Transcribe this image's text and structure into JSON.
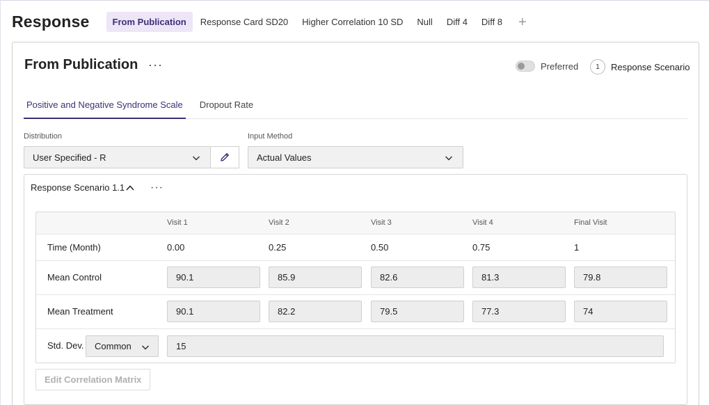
{
  "header": {
    "title": "Response",
    "tabs": [
      {
        "label": "From Publication",
        "active": true
      },
      {
        "label": "Response Card SD20",
        "active": false
      },
      {
        "label": "Higher Correlation 10 SD",
        "active": false
      },
      {
        "label": "Null",
        "active": false
      },
      {
        "label": "Diff 4",
        "active": false
      },
      {
        "label": "Diff 8",
        "active": false
      }
    ],
    "add_tab_symbol": "+"
  },
  "card": {
    "title": "From Publication",
    "more_symbol": "···",
    "preferred_label": "Preferred",
    "preferred_on": false,
    "scenario_count": "1",
    "scenario_count_label": "Response Scenario"
  },
  "inner_tabs": [
    {
      "label": "Positive and Negative Syndrome Scale",
      "active": true
    },
    {
      "label": "Dropout Rate",
      "active": false
    }
  ],
  "form": {
    "distribution_label": "Distribution",
    "distribution_value": "User Specified - R",
    "input_method_label": "Input Method",
    "input_method_value": "Actual Values"
  },
  "scenario": {
    "title": "Response Scenario 1.1",
    "more_symbol": "···",
    "columns": [
      "Visit 1",
      "Visit 2",
      "Visit 3",
      "Visit 4",
      "Final Visit"
    ],
    "time_label": "Time (Month)",
    "time_values": [
      "0.00",
      "0.25",
      "0.50",
      "0.75",
      "1"
    ],
    "mean_control_label": "Mean Control",
    "mean_control": [
      "90.1",
      "85.9",
      "82.6",
      "81.3",
      "79.8"
    ],
    "mean_treatment_label": "Mean Treatment",
    "mean_treatment": [
      "90.1",
      "82.2",
      "79.5",
      "77.3",
      "74"
    ],
    "sd_label": "Std. Dev.",
    "sd_mode": "Common",
    "sd_value": "15",
    "edit_matrix_label": "Edit Correlation Matrix"
  },
  "colors": {
    "accent": "#3c2f77",
    "active_tab_bg": "#ece6f7",
    "input_bg": "#ededed"
  }
}
